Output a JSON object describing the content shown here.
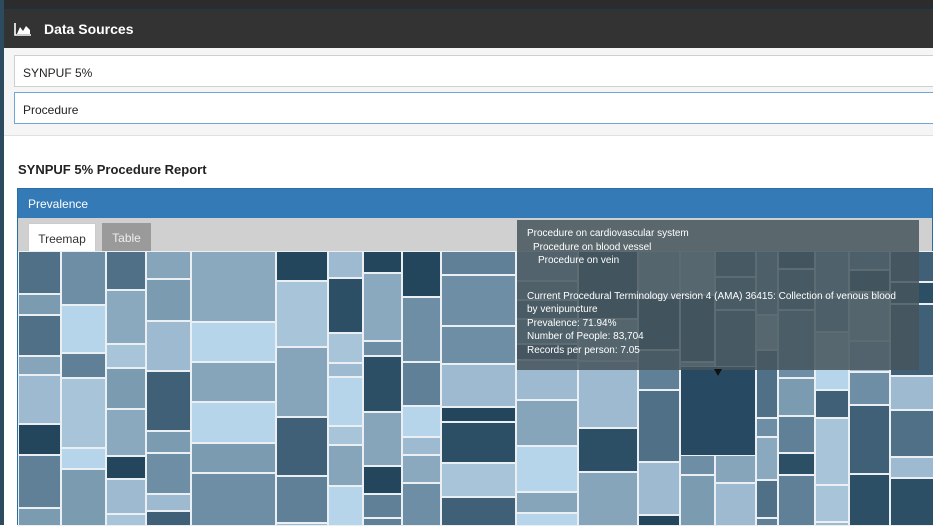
{
  "header": {
    "title": "Data Sources",
    "icon": "area-chart-icon"
  },
  "selectors": {
    "source": "SYNPUF 5%",
    "domain": "Procedure"
  },
  "report": {
    "title": "SYNPUF 5% Procedure Report"
  },
  "panel": {
    "title": "Prevalence"
  },
  "tabs": [
    {
      "label": "Treemap",
      "active": true
    },
    {
      "label": "Table",
      "active": false
    }
  ],
  "tooltip": {
    "line1": "Procedure on cardiovascular system",
    "line2": "Procedure on blood vessel",
    "line3": "Procedure on vein",
    "concept": "Current Procedural Terminology version 4 (AMA) 36415: Collection of venous blood by venipuncture",
    "prevalence": "Prevalence: 71.94%",
    "people": "Number of People: 83,704",
    "records": "Records per person: 7.05"
  },
  "colors": {
    "header_bg": "#333333",
    "panel_head": "#337ab7",
    "cell_dark": "#254961",
    "cell_light": "#b8d8ec"
  }
}
